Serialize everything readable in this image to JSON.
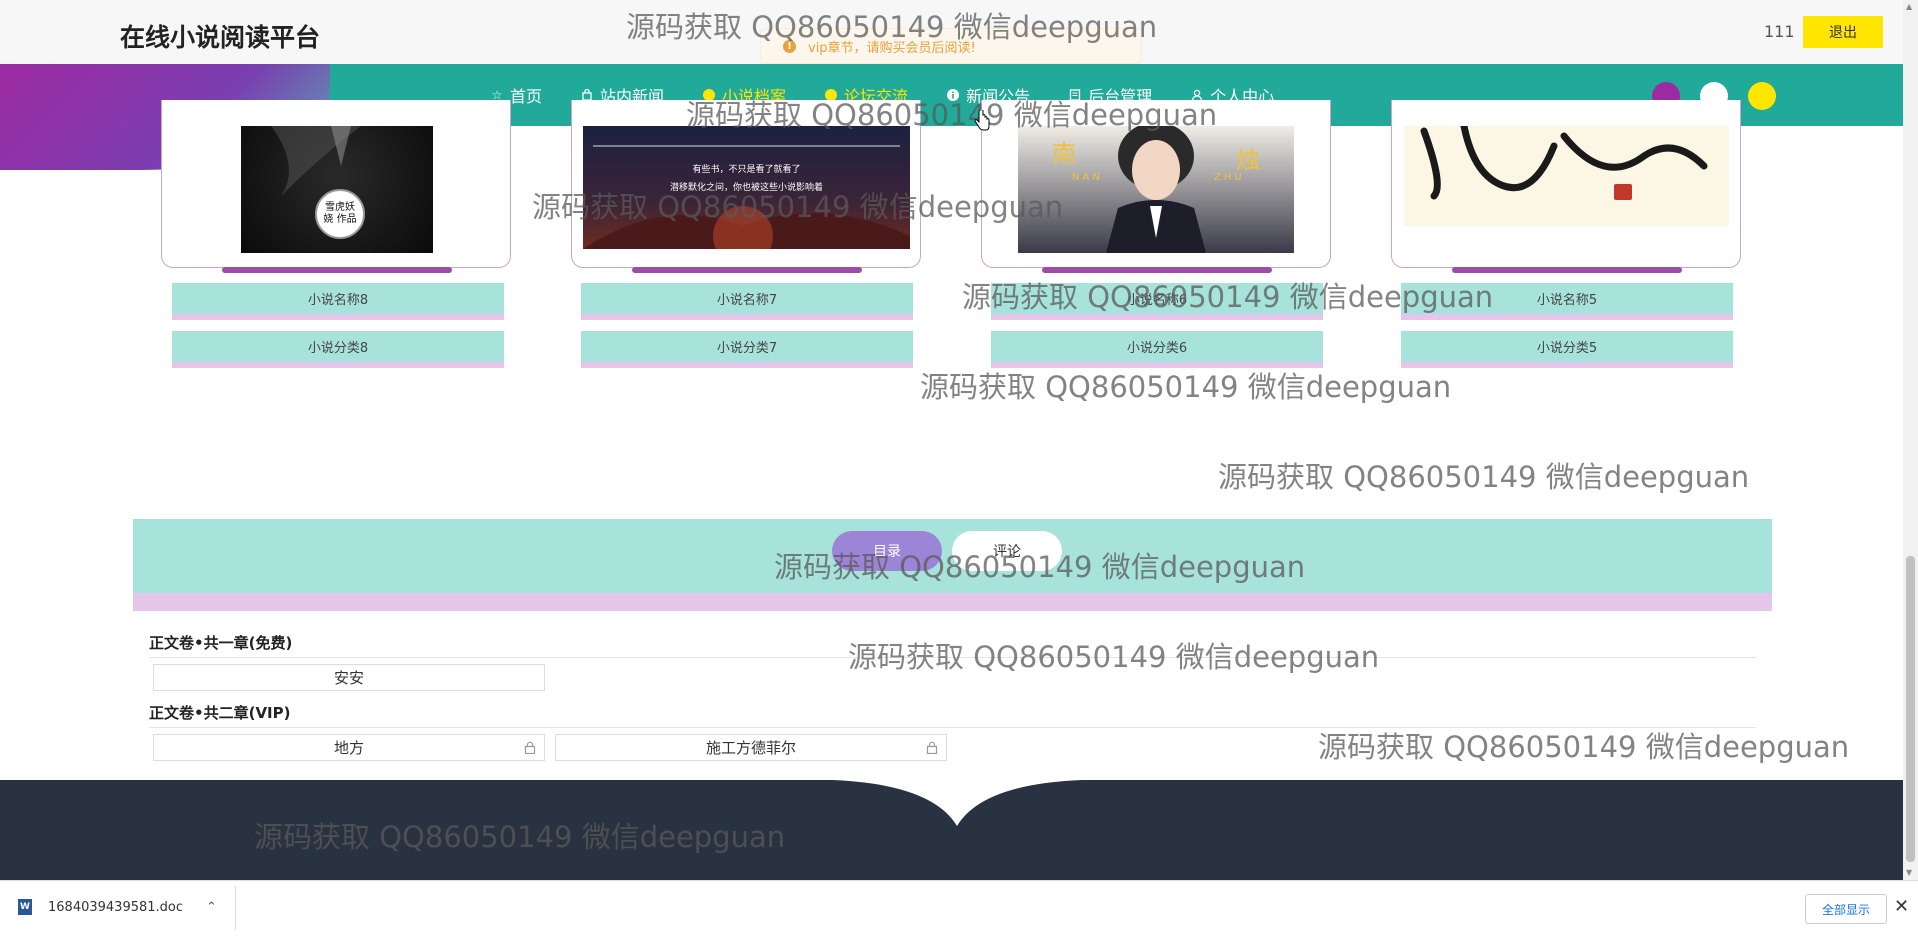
{
  "header": {
    "site_title": "在线小说阅读平台",
    "username": "111",
    "logout_label": "退出"
  },
  "toast": {
    "message": "vip章节，请购买会员后阅读!"
  },
  "nav": {
    "items": [
      {
        "label": "首页",
        "icon": "star-icon"
      },
      {
        "label": "站内新闻",
        "icon": "bag-icon"
      },
      {
        "label": "小说档案",
        "icon": "info-icon",
        "active": true
      },
      {
        "label": "论坛交流",
        "icon": "info-icon"
      },
      {
        "label": "新闻公告",
        "icon": "info-icon"
      },
      {
        "label": "后台管理",
        "icon": "doc-icon"
      },
      {
        "label": "个人中心",
        "icon": "user-icon"
      }
    ],
    "theme_colors": [
      "#9d2aa2",
      "#ffffff",
      "#ffe600"
    ]
  },
  "books": [
    {
      "name": "小说名称8",
      "category": "小说分类8"
    },
    {
      "name": "小说名称7",
      "category": "小说分类7"
    },
    {
      "name": "小说名称6",
      "category": "小说分类6"
    },
    {
      "name": "小说名称5",
      "category": "小说分类5"
    }
  ],
  "covers": {
    "book8": {
      "badge": "雪虎妖娆 作品"
    },
    "book7": {
      "line1": "有些书，不只是看了就看了",
      "line2": "潜移默化之间，你也被这些小说影响着"
    },
    "book6": {
      "left_char": "南",
      "right_char": "烛",
      "left_pinyin": "NAN",
      "right_pinyin": "ZHU"
    }
  },
  "tabs": {
    "catalog": "目录",
    "comment": "评论"
  },
  "volumes": [
    {
      "title": "正文卷•共一章(免费)",
      "chapters": [
        {
          "name": "安安",
          "locked": false
        }
      ]
    },
    {
      "title": "正文卷•共二章(VIP)",
      "chapters": [
        {
          "name": "地方",
          "locked": true
        },
        {
          "name": "施工方德菲尔",
          "locked": true
        }
      ]
    }
  ],
  "watermark": "源码获取 QQ86050149 微信deepguan",
  "download_bar": {
    "file_name": "1684039439581.doc",
    "show_all_label": "全部显示"
  },
  "colors": {
    "nav_bg": "#21a99a",
    "accent_yellow": "#ffe600",
    "button_bar": "#a7e3db",
    "button_bar_border": "#e5c6ea",
    "footer_bg": "#283240"
  }
}
